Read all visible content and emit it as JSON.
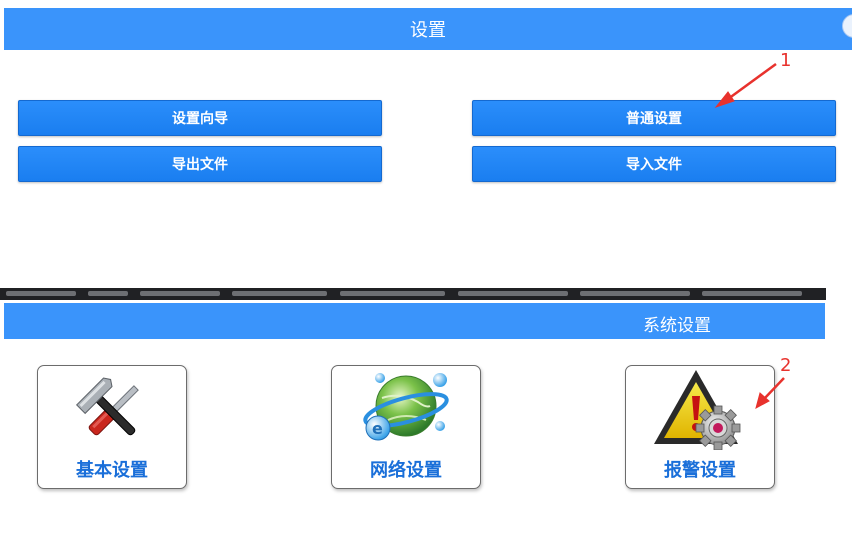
{
  "settings": {
    "title": "设置",
    "buttons": {
      "setup_wizard": "设置向导",
      "general_settings": "普通设置",
      "export_file": "导出文件",
      "import_file": "导入文件"
    }
  },
  "system_settings": {
    "title": "系统设置",
    "tiles": {
      "basic": {
        "label": "基本设置",
        "icon": "tools-icon"
      },
      "network": {
        "label": "网络设置",
        "icon": "globe-network-icon"
      },
      "alarm": {
        "label": "报警设置",
        "icon": "warning-gear-icon"
      }
    }
  },
  "annotations": {
    "marker_1": "1",
    "marker_2": "2",
    "color": "#e8322d"
  },
  "colors": {
    "header_blue": "#3a94fb",
    "button_blue": "#1a7ef0",
    "tile_label_blue": "#1a6fd9"
  }
}
